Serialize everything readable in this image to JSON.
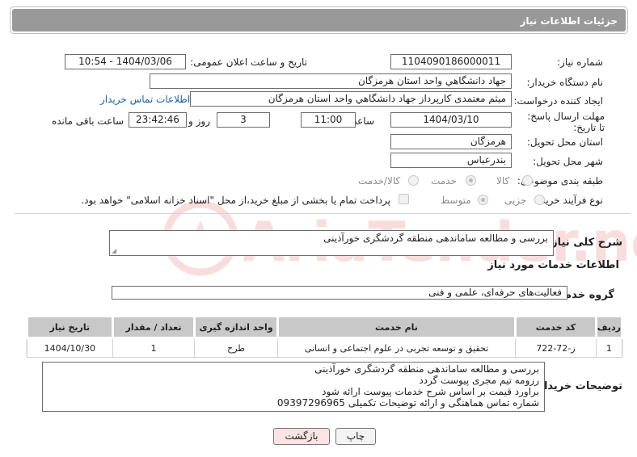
{
  "header": {
    "title": "جزئیات اطلاعات نیاز"
  },
  "labels": {
    "need_number": "شماره نیاز:",
    "announce_datetime": "تاریخ و ساعت اعلان عمومی:",
    "buyer_org": "نام دستگاه خریدار:",
    "requester": "ایجاد کننده درخواست:",
    "buyer_contact": "اطلاعات تماس خریدار",
    "deadline": "مهلت ارسال پاسخ: تا تاریخ:",
    "time": "ساعت",
    "day_and": "روز و",
    "remaining": "ساعت باقی مانده",
    "province": "استان محل تحویل:",
    "city": "شهر محل تحویل:",
    "category": "طبقه بندی موضوعی:",
    "purchase_type": "نوع فرآیند خرید :",
    "general_desc": "شرح کلی نیاز:",
    "services_info": "اطلاعات خدمات مورد نیاز",
    "service_group": "گروه خدمت:",
    "buyer_notes": "توضیحات خریدار:"
  },
  "values": {
    "need_number": "1104090186000011",
    "announce_datetime": "1404/03/06 - 10:54",
    "buyer_org": "جهاد دانشگاهي واحد استان هرمزگان",
    "requester": "میثم معتمدی کارپرداز جهاد دانشگاهي واحد استان هرمزگان",
    "deadline_date": "1404/03/10",
    "deadline_time": "11:00",
    "days": "3",
    "remaining_time": "23:42:46",
    "province": "هرمزگان",
    "city": "بندرعباس",
    "general_desc": "بررسی و مطالعه ساماندهی منطقه گردشگری خورآذینی",
    "service_group": "فعالیت‌های حرفه‌ای، علمی و فنی"
  },
  "category_options": {
    "goods": "کالا",
    "service": "خدمت",
    "goods_service": "کالا/خدمت"
  },
  "purchase_options": {
    "partial": "جزیی",
    "medium": "متوسط",
    "treasury_note": "پرداخت تمام یا بخشی از مبلغ خرید،از محل \"اسناد خزانه اسلامی\" خواهد بود."
  },
  "table": {
    "headers": [
      "ردیف",
      "کد خدمت",
      "نام خدمت",
      "واحد اندازه گیری",
      "تعداد / مقدار",
      "تاریخ نیاز"
    ],
    "rows": [
      [
        "1",
        "ز-72-722",
        "تحقیق و توسعه تجربی در علوم اجتماعی و انسانی",
        "طرح",
        "1",
        "1404/10/30"
      ]
    ]
  },
  "buyer_notes": [
    "بررسی و مطالعه ساماندهی منطقه گردشگری خورآذینی",
    "رزومه تیم مجری پیوست گردد",
    "براورد قیمت بر اساس شرح خدمات پیوست ارائه شود",
    "شماره تماس هماهنگی و ارائه توضیحات تکمیلی 09397296965"
  ],
  "buttons": {
    "print": "چاپ",
    "back": "بازگشت"
  },
  "watermark": {
    "text": "AriaTender.net"
  }
}
